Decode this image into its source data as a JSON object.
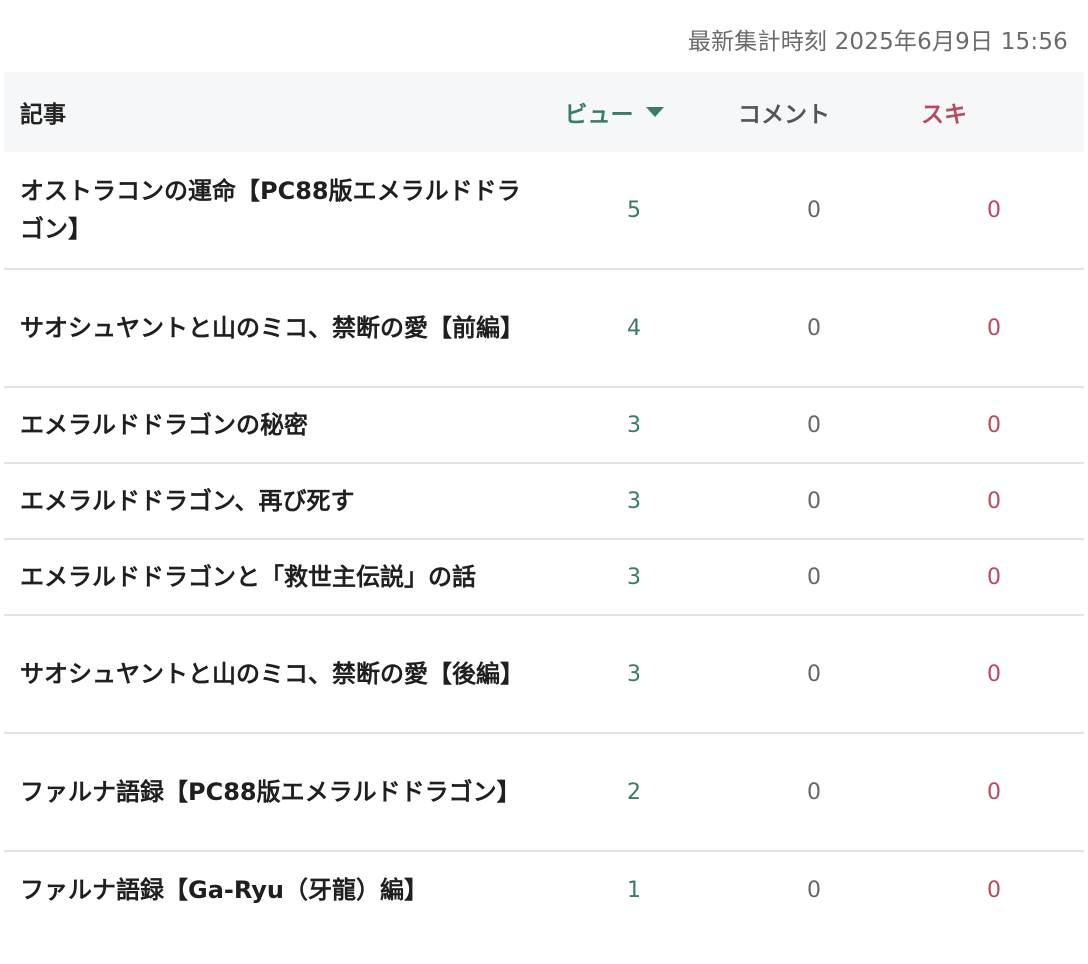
{
  "timestamp": "最新集計時刻 2025年6月9日 15:56",
  "header": {
    "article": "記事",
    "views": "ビュー",
    "comments": "コメント",
    "likes": "スキ"
  },
  "rows": [
    {
      "title": "オストラコンの運命【PC88版エメラルドドラゴン】",
      "views": "5",
      "comments": "0",
      "likes": "0",
      "size": "tall"
    },
    {
      "title": "サオシュヤントと山のミコ、禁断の愛【前編】",
      "views": "4",
      "comments": "0",
      "likes": "0",
      "size": "tall"
    },
    {
      "title": "エメラルドドラゴンの秘密",
      "views": "3",
      "comments": "0",
      "likes": "0",
      "size": "short"
    },
    {
      "title": "エメラルドドラゴン、再び死す",
      "views": "3",
      "comments": "0",
      "likes": "0",
      "size": "short"
    },
    {
      "title": "エメラルドドラゴンと「救世主伝説」の話",
      "views": "3",
      "comments": "0",
      "likes": "0",
      "size": "short"
    },
    {
      "title": "サオシュヤントと山のミコ、禁断の愛【後編】",
      "views": "3",
      "comments": "0",
      "likes": "0",
      "size": "tall"
    },
    {
      "title": "ファルナ語録【PC88版エメラルドドラゴン】",
      "views": "2",
      "comments": "0",
      "likes": "0",
      "size": "tall"
    },
    {
      "title": "ファルナ語録【Ga-Ryu（牙龍）編】",
      "views": "1",
      "comments": "0",
      "likes": "0",
      "size": "short"
    }
  ]
}
